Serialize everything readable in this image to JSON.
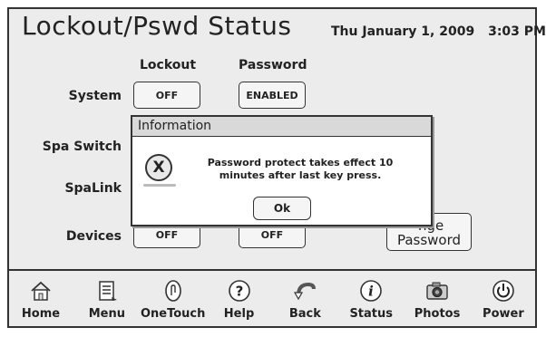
{
  "header": {
    "title": "Lockout/Pswd Status",
    "date": "Thu January 1, 2009",
    "time": "3:03 PM"
  },
  "columns": {
    "lockout": "Lockout",
    "password": "Password"
  },
  "rows": {
    "system": {
      "label": "System",
      "lockout": "OFF",
      "password": "ENABLED"
    },
    "spa_switch": {
      "label": "Spa Switch"
    },
    "spalink": {
      "label": "SpaLink"
    },
    "devices": {
      "label": "Devices",
      "lockout": "OFF",
      "password": "OFF"
    }
  },
  "change_password": {
    "line1": "Change",
    "line2": "Password",
    "visible_line1": "nge"
  },
  "dialog": {
    "title": "Information",
    "icon": "close-x-icon",
    "icon_glyph": "X",
    "message_line1": "Password protect takes effect 10",
    "message_line2": "minutes after last key press.",
    "ok_label": "Ok"
  },
  "nav": [
    {
      "label": "Home",
      "icon": "home-icon"
    },
    {
      "label": "Menu",
      "icon": "menu-icon"
    },
    {
      "label": "OneTouch",
      "icon": "onetouch-icon"
    },
    {
      "label": "Help",
      "icon": "help-icon"
    },
    {
      "label": "Back",
      "icon": "back-icon"
    },
    {
      "label": "Status",
      "icon": "status-icon"
    },
    {
      "label": "Photos",
      "icon": "camera-icon"
    },
    {
      "label": "Power",
      "icon": "power-icon"
    }
  ]
}
